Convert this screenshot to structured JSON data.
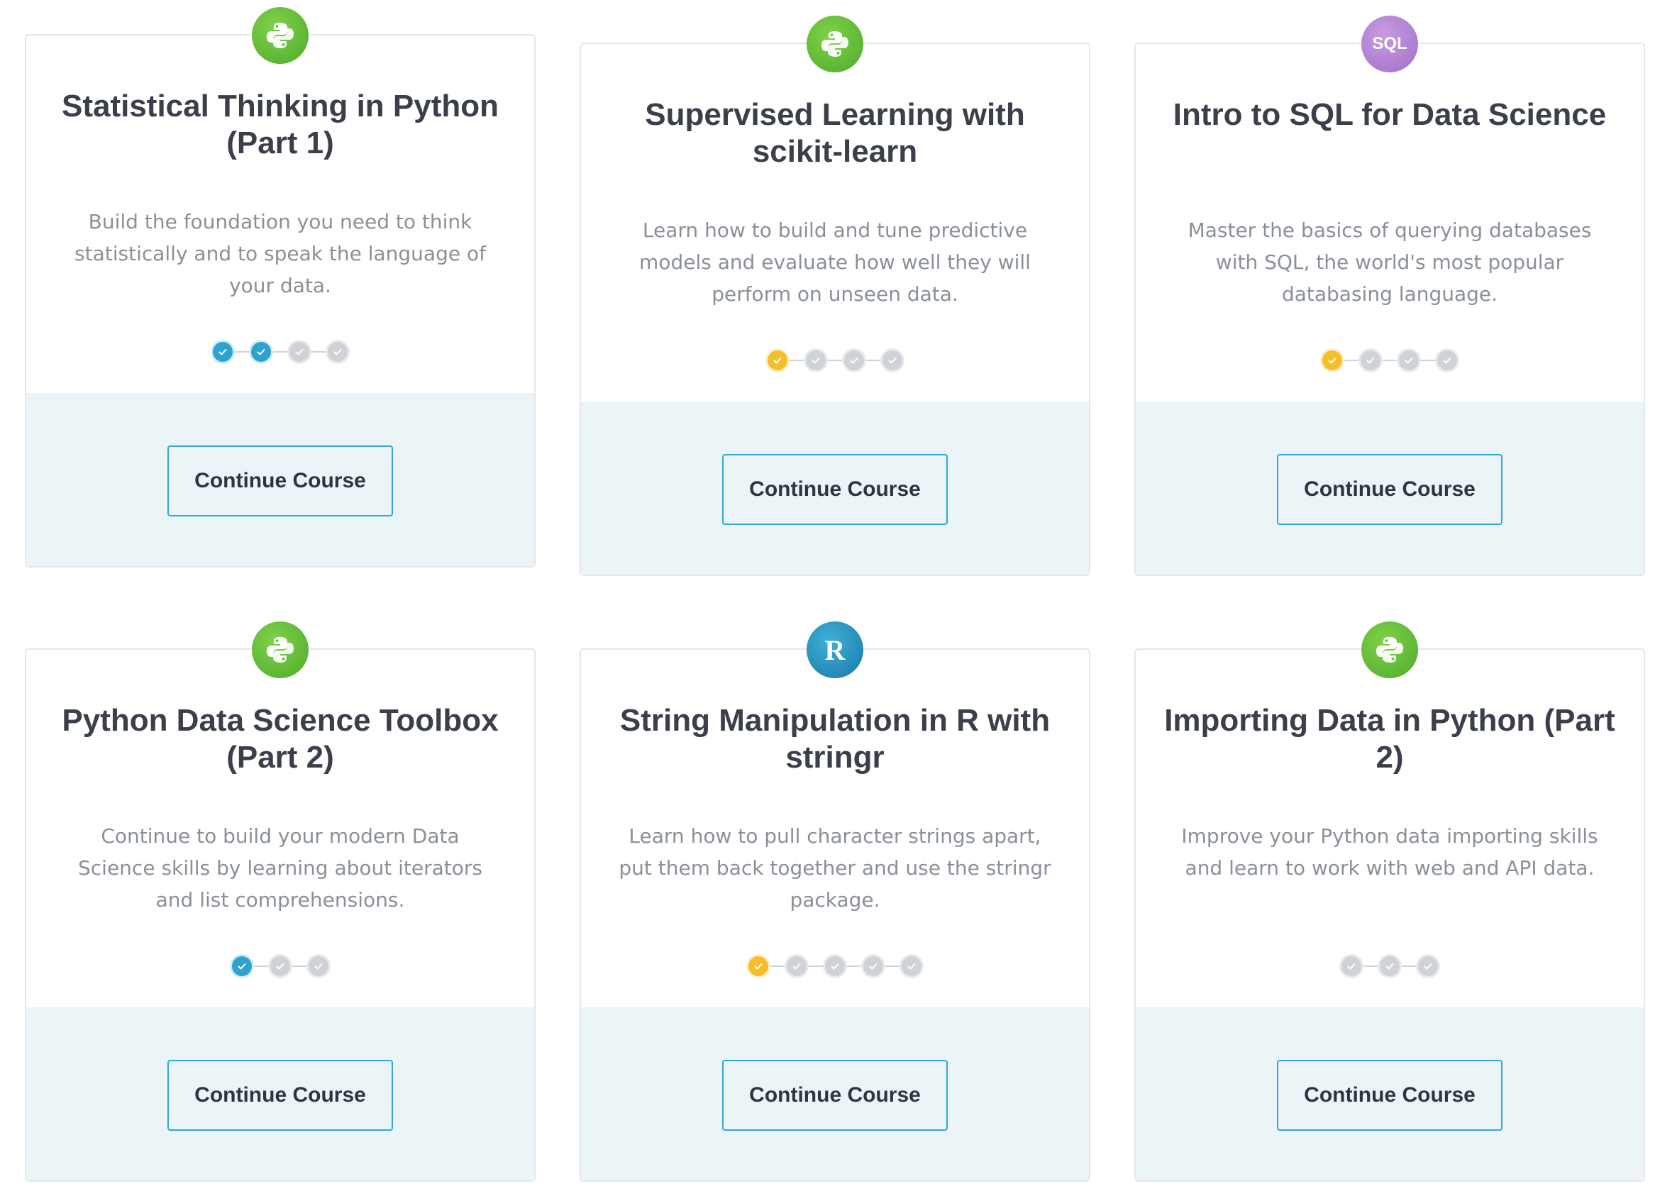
{
  "courses": [
    {
      "icon": "python-icon",
      "badge_text": "",
      "title": "Statistical Thinking in Python (Part 1)",
      "description": "Build the foundation you need to think statistically and to speak the language of your data.",
      "progress": {
        "completed": 2,
        "total": 4,
        "color": "#2fa3cf"
      },
      "button_label": "Continue Course"
    },
    {
      "icon": "python-icon",
      "badge_text": "",
      "title": "Supervised Learning with scikit-learn",
      "description": "Learn how to build and tune predictive models and evaluate how well they will perform on unseen data.",
      "progress": {
        "completed": 1,
        "total": 4,
        "color": "#f5be2b"
      },
      "button_label": "Continue Course"
    },
    {
      "icon": "sql-icon",
      "badge_text": "SQL",
      "title": "Intro to SQL for Data Science",
      "description": "Master the basics of querying databases with SQL, the world's most popular databasing language.",
      "progress": {
        "completed": 1,
        "total": 4,
        "color": "#f5be2b"
      },
      "button_label": "Continue Course"
    },
    {
      "icon": "python-icon",
      "badge_text": "",
      "title": "Python Data Science Toolbox (Part 2)",
      "description": "Continue to build your modern Data Science skills by learning about iterators and list comprehensions.",
      "progress": {
        "completed": 1,
        "total": 3,
        "color": "#2fa3cf"
      },
      "button_label": "Continue Course"
    },
    {
      "icon": "r-icon",
      "badge_text": "R",
      "title": "String Manipulation in R with stringr",
      "description": "Learn how to pull character strings apart, put them back together and use the stringr package.",
      "progress": {
        "completed": 1,
        "total": 5,
        "color": "#f5be2b"
      },
      "button_label": "Continue Course"
    },
    {
      "icon": "python-icon",
      "badge_text": "",
      "title": "Importing Data in Python (Part 2)",
      "description": "Improve your Python data importing skills and learn to work with web and API data.",
      "progress": {
        "completed": 0,
        "total": 3,
        "color": "#2fa3cf"
      },
      "button_label": "Continue Course"
    }
  ],
  "colors": {
    "python_badge": "#5cb82f",
    "sql_badge": "#a574cc",
    "r_badge": "#1f86b8",
    "button_border": "#33a7d4",
    "card_footer": "#ebf4f7"
  }
}
